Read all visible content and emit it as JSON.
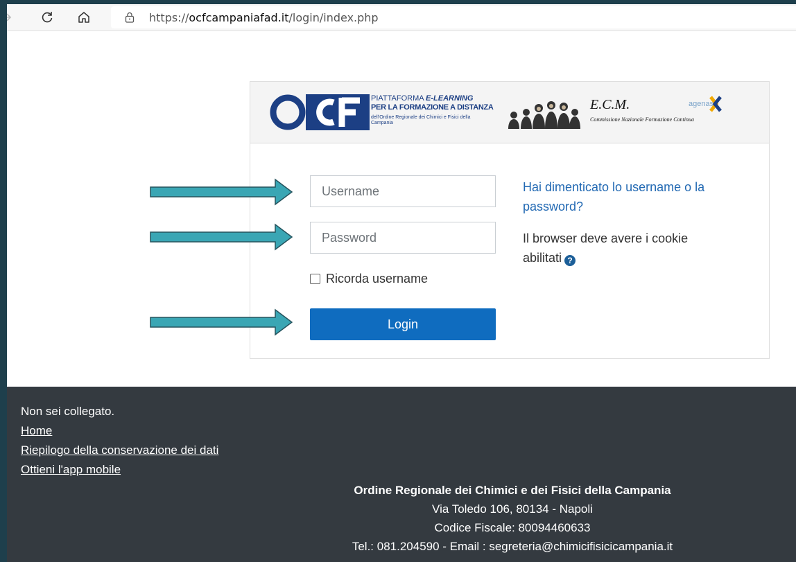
{
  "browser": {
    "url_prefix": "https://",
    "url_domain": "ocfcampaniafad.it",
    "url_path": "/login/index.php"
  },
  "header": {
    "ocf_logo_text": "OCF",
    "ocf_line1_prefix": "PIATTAFORMA ",
    "ocf_line1_em": "E-LEARNING",
    "ocf_line2": "PER LA FORMAZIONE A DISTANZA",
    "ocf_line3": "dell'Ordine Regionale dei Chimici e Fisici della Campania",
    "ecm_title": "E.C.M.",
    "ecm_subtitle": "Commissione Nazionale Formazione Continua",
    "agenas": "agenas"
  },
  "login": {
    "username_placeholder": "Username",
    "password_placeholder": "Password",
    "remember_label": "Ricorda username",
    "login_button": "Login",
    "forgot_link": "Hai dimenticato lo username o la password?",
    "cookie_notice": "Il browser deve avere i cookie abilitati"
  },
  "footer": {
    "not_logged": "Non sei collegato.",
    "home_link": "Home",
    "retention_link": "Riepilogo della conservazione dei dati",
    "app_link": "Ottieni l'app mobile",
    "org_name": "Ordine Regionale dei Chimici e dei Fisici della Campania",
    "org_address": "Via Toledo 106, 80134 - Napoli",
    "org_tax": "Codice Fiscale: 80094460633",
    "org_contacts": "Tel.: 081.204590 - Email : segreteria@chimicifisicicampania.it"
  },
  "colors": {
    "frame_bg": "#1e3f4c",
    "login_button": "#0f6cbf",
    "link": "#2269b3",
    "footer_bg": "#343a40",
    "arrow": "#3aa6b4"
  }
}
